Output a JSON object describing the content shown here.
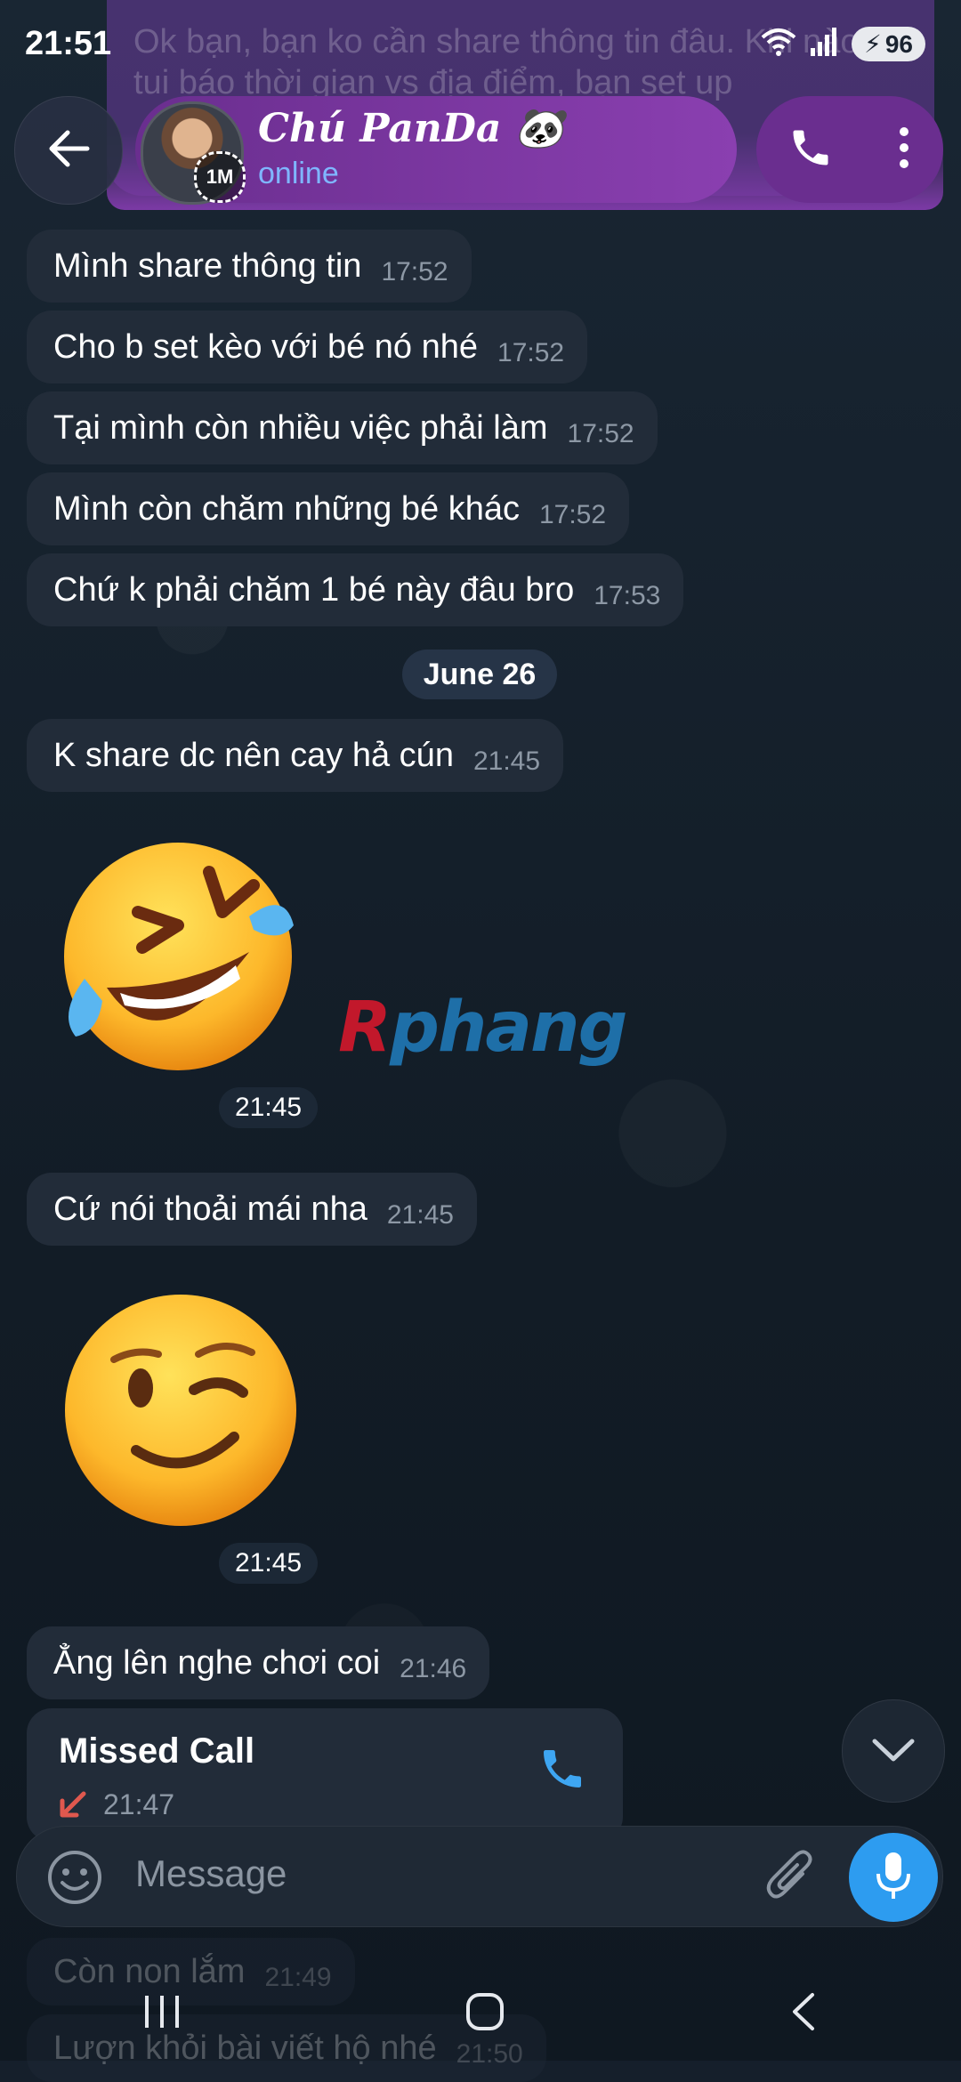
{
  "status": {
    "time": "21:51",
    "battery": "96"
  },
  "notification_ghost": {
    "text": "Ok bạn, bạn ko cần share thông tin đâu. Khi nào đi tui báo thời gian vs địa điểm, bạn set up"
  },
  "header": {
    "name": "Chú PanDa 🐼",
    "status": "online",
    "avatar_badge": "1M"
  },
  "messages_top": [
    {
      "text": "Mình share thông tin",
      "time": "17:52"
    },
    {
      "text": "Cho b set kèo với bé nó nhé",
      "time": "17:52"
    },
    {
      "text": "Tại mình còn nhiều việc phải làm",
      "time": "17:52"
    },
    {
      "text": "Mình còn chăm những bé khác",
      "time": "17:52"
    },
    {
      "text": "Chứ k phải chăm 1 bé này đâu bro",
      "time": "17:53"
    }
  ],
  "date_divider": "June 26",
  "message_after_date": {
    "text": "K share dc nên cay hả cún",
    "time": "21:45"
  },
  "sticker1": {
    "emoji": "rolling-on-floor-laughing",
    "time": "21:45"
  },
  "watermark": {
    "first": "R",
    "rest": "phang"
  },
  "message_mid": {
    "text": "Cứ nói thoải mái nha",
    "time": "21:45"
  },
  "sticker2": {
    "emoji": "winking-face",
    "time": "21:45"
  },
  "message_last": {
    "text": "Ẳng lên nghe chơi coi",
    "time": "21:46"
  },
  "missed_call": {
    "title": "Missed Call",
    "time": "21:47"
  },
  "input": {
    "placeholder": "Message"
  },
  "faded_messages": [
    {
      "text": "Còn non lắm",
      "time": "21:49"
    },
    {
      "text": "Lượn khỏi bài viết hộ nhé",
      "time": "21:50"
    }
  ],
  "colors": {
    "accent": "#2d9cf0",
    "header": "#7c3aa6",
    "bubble": "#222c39",
    "missed": "#e0584e"
  }
}
